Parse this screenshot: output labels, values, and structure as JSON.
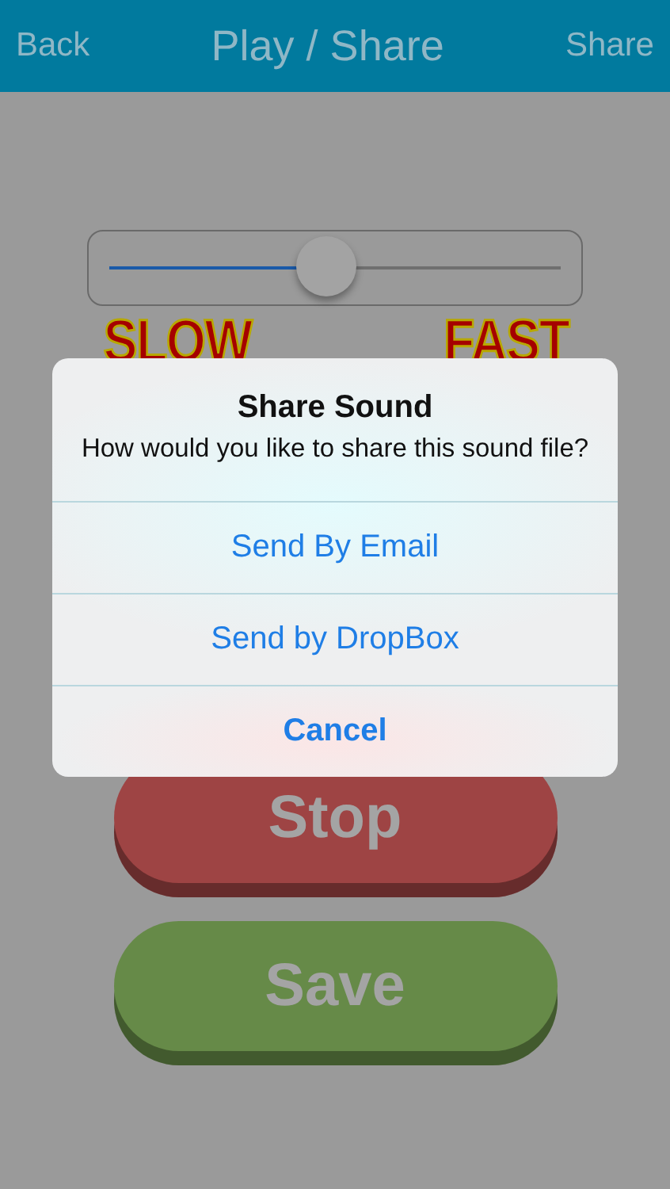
{
  "nav_bar": {
    "back": "Back",
    "title": "Play / Share",
    "action": "Share"
  },
  "speed_slider": {
    "level": 0.48,
    "min_label": "SLOW",
    "max_label": "FAST"
  },
  "buttons": [
    {
      "label": "Stop",
      "color": "#9e4444"
    },
    {
      "label": "Save",
      "color": "#668a48"
    }
  ],
  "alert": {
    "title": "Share Sound",
    "message": "How would you like to share this sound file?",
    "actions": [
      {
        "label": "Send By Email",
        "kind": "default"
      },
      {
        "label": "Send by DropBox",
        "kind": "default"
      },
      {
        "label": "Cancel",
        "kind": "cancel"
      }
    ]
  }
}
